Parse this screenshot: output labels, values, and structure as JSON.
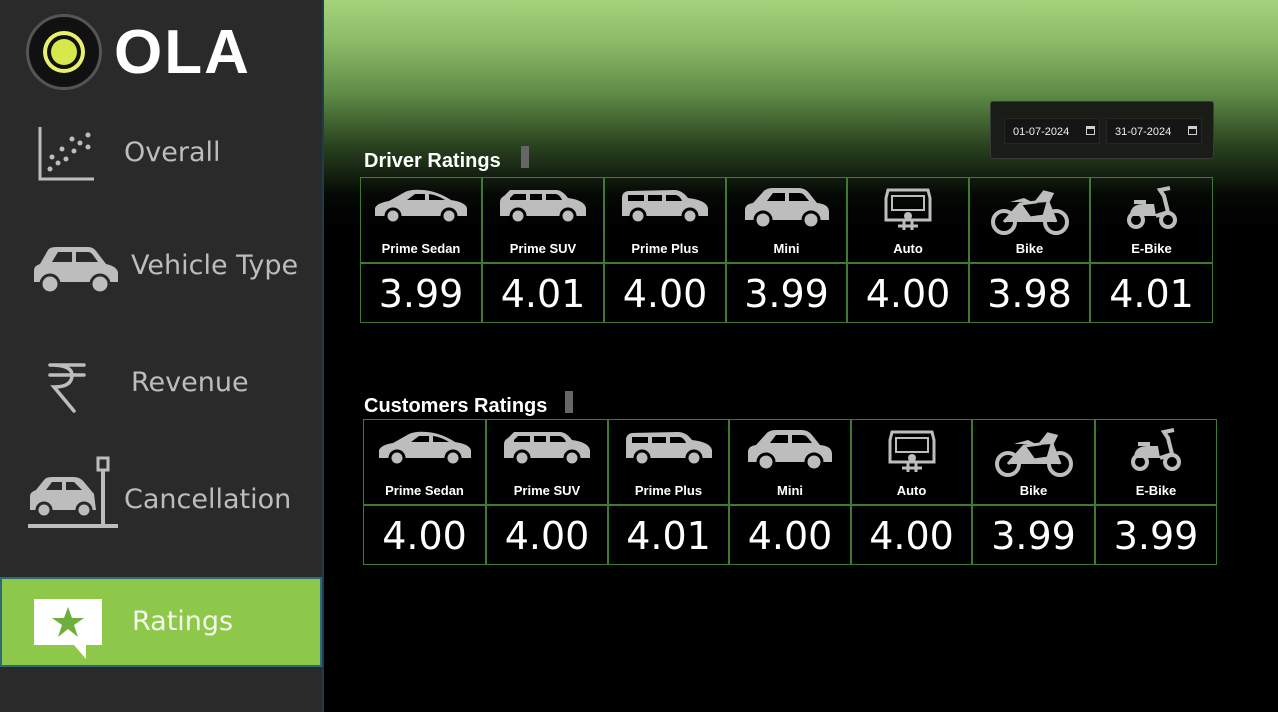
{
  "logo": {
    "text": "OLA"
  },
  "nav": [
    {
      "label": "Overall",
      "icon": "scatter-chart-icon",
      "active": false
    },
    {
      "label": "Vehicle Type",
      "icon": "car-icon",
      "active": false
    },
    {
      "label": "Revenue",
      "icon": "rupee-icon",
      "active": false
    },
    {
      "label": "Cancellation",
      "icon": "car-crash-icon",
      "active": false
    },
    {
      "label": "Ratings",
      "icon": "star-message-icon",
      "active": true
    }
  ],
  "date_range": {
    "start": "01-07-2024",
    "end": "31-07-2024"
  },
  "driver_ratings": {
    "title": "Driver Ratings",
    "items": [
      {
        "vehicle": "Prime Sedan",
        "icon": "sedan-icon",
        "value": "3.99"
      },
      {
        "vehicle": "Prime SUV",
        "icon": "suv-icon",
        "value": "4.01"
      },
      {
        "vehicle": "Prime Plus",
        "icon": "wagon-icon",
        "value": "4.00"
      },
      {
        "vehicle": "Mini",
        "icon": "hatchback-icon",
        "value": "3.99"
      },
      {
        "vehicle": "Auto",
        "icon": "auto-rickshaw-icon",
        "value": "4.00"
      },
      {
        "vehicle": "Bike",
        "icon": "motorbike-icon",
        "value": "3.98"
      },
      {
        "vehicle": "E-Bike",
        "icon": "scooter-icon",
        "value": "4.01"
      }
    ]
  },
  "customer_ratings": {
    "title": "Customers Ratings",
    "items": [
      {
        "vehicle": "Prime Sedan",
        "icon": "sedan-icon",
        "value": "4.00"
      },
      {
        "vehicle": "Prime SUV",
        "icon": "suv-icon",
        "value": "4.00"
      },
      {
        "vehicle": "Prime Plus",
        "icon": "wagon-icon",
        "value": "4.01"
      },
      {
        "vehicle": "Mini",
        "icon": "hatchback-icon",
        "value": "4.00"
      },
      {
        "vehicle": "Auto",
        "icon": "auto-rickshaw-icon",
        "value": "4.00"
      },
      {
        "vehicle": "Bike",
        "icon": "motorbike-icon",
        "value": "3.99"
      },
      {
        "vehicle": "E-Bike",
        "icon": "scooter-icon",
        "value": "3.99"
      }
    ]
  },
  "colors": {
    "accent": "#8dc84b",
    "sidebar": "#2a2a2a",
    "grid": "#3f7a32",
    "header_top": "#a4d37c"
  }
}
